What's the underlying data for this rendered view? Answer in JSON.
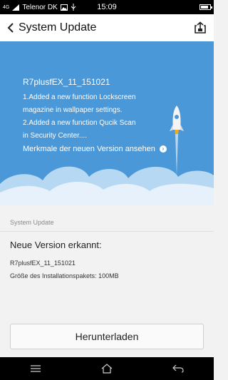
{
  "status_bar": {
    "carrier": "Telenor DK",
    "signal_label": "4G",
    "time": "15:09",
    "battery_level": 0.8
  },
  "app_bar": {
    "title": "System Update",
    "back_icon": "chevron-left-icon",
    "export_icon": "export-icon"
  },
  "hero": {
    "version": "R7plusfEX_11_151021",
    "notes": [
      "1.Added a new function Lockscreen",
      "magazine in wallpaper settings.",
      "2.Added a new function Qucik Scan",
      "in Security Center...."
    ],
    "details_link": "Merkmale der neuen Version ansehen",
    "background_color": "#4b98d8"
  },
  "info": {
    "section_label": "System Update",
    "found_text": "Neue Version erkannt:",
    "version_line": "R7plusfEX_11_151021",
    "size_line": "Größe des Installationspakets: 100MB"
  },
  "download_button": {
    "label": "Herunterladen"
  },
  "nav_bar": {
    "menu_icon": "menu-icon",
    "home_icon": "home-icon",
    "back_icon": "back-arrow-icon"
  }
}
